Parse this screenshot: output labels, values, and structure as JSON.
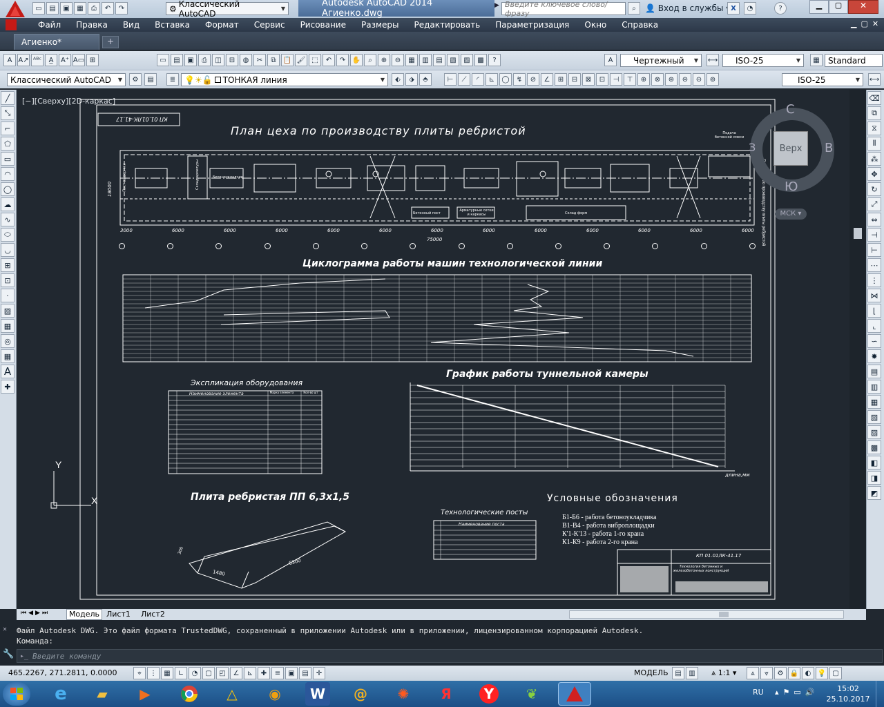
{
  "window": {
    "workspace": "Классический AutoCAD",
    "title": "Autodesk AutoCAD 2014    Агиенко.dwg",
    "search_placeholder": "Введите ключевое слово/фразу",
    "signin": "Вход в службы",
    "help": "?"
  },
  "menu": [
    "Файл",
    "Правка",
    "Вид",
    "Вставка",
    "Формат",
    "Сервис",
    "Рисование",
    "Размеры",
    "Редактировать",
    "Параметризация",
    "Окно",
    "Справка"
  ],
  "doc_tab": "Агиенко*",
  "toolbar1": {
    "text_style": "Чертежный",
    "dim_style": "ISO-25",
    "table_style": "Standard"
  },
  "toolbar2": {
    "workspace": "Классический AutoCAD",
    "layer": "ТОНКАЯ линия",
    "dim_style2": "ISO-25"
  },
  "viewport_label": "[−][Сверху][2D-каркас]",
  "viewcube": {
    "top": "Верх",
    "north": "С",
    "south": "Ю",
    "east": "В",
    "west": "З",
    "ucs": "МСК"
  },
  "drawing": {
    "stamp_code": "КП 01.01ЛК-41.17",
    "title_plan": "План цеха по производству плиты ребристой",
    "title_cyclogram": "Циклограмма работы машин технологической линии",
    "title_tunnel": "График работы туннельной камеры",
    "title_explication": "Экспликация оборудования",
    "title_slab": "Плита ребристая ПП 6,3х1,5",
    "title_legend": "Условные обозначения",
    "title_posts": "Технологические посты",
    "plan_dims": [
      "3000",
      "6000",
      "6000",
      "6000",
      "6000",
      "6000",
      "6000",
      "6000",
      "6000",
      "6000",
      "6000",
      "6000",
      "6000"
    ],
    "plan_total": "75000",
    "plan_height": "18000",
    "plan_labels": [
      "Пост выдержки",
      "Склад арматуры",
      "Бетоноукладчик",
      "Склад форм",
      "Бетонный пост",
      "Арматурные сетки и каркасы",
      "Подача бетонной смеси"
    ],
    "legend": [
      "Б1-Б6 - работа бетоноукладчика",
      "В1-В4  - работа виброплощадки",
      "К'1-К'13 - работа 1-го крана",
      "К1-К9 - работа 2-го крана"
    ],
    "explication_headers": [
      "Наименование элемента",
      "Марка элемента",
      "Кол-во шт"
    ],
    "posts_header": "Наименование поста",
    "tunnel_axis_x": "длина,мм",
    "slab_dims": [
      "6300",
      "1480",
      "300"
    ],
    "title_block": "Технология бетонных и железобетонных конструкций"
  },
  "layout_tabs": [
    "Модель",
    "Лист1",
    "Лист2"
  ],
  "command": {
    "history1": "Файл Autodesk DWG. Это файл формата TrustedDWG, сохраненный в приложении Autodesk или в приложении, лицензированном корпорацией Autodesk.",
    "history2": "Команда:",
    "placeholder": "Введите команду"
  },
  "status": {
    "coords": "465.2267, 271.2811, 0.0000",
    "model": "МОДЕЛЬ",
    "scale": "1:1"
  },
  "taskbar": {
    "lang": "RU",
    "time": "15:02",
    "date": "25.10.2017"
  }
}
